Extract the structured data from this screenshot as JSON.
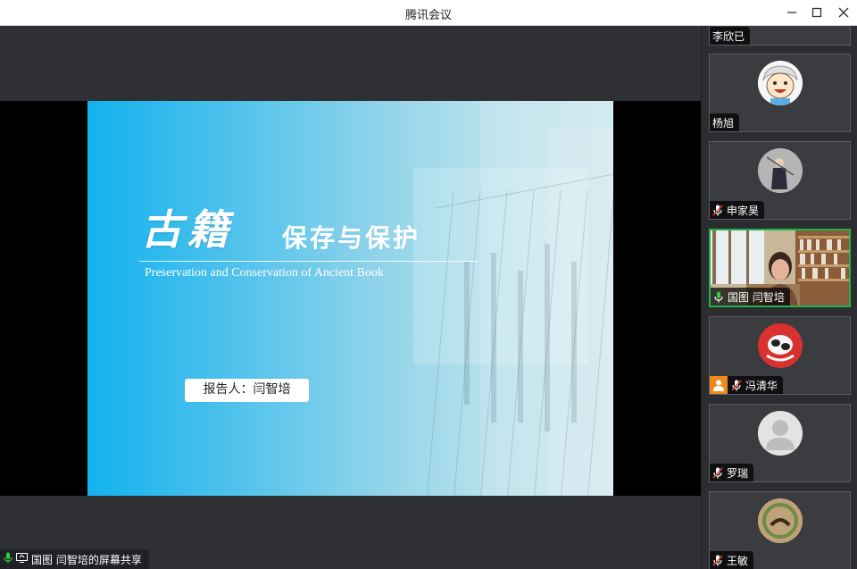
{
  "window": {
    "title": "腾讯会议",
    "minimize_icon": "minimize-icon",
    "maximize_icon": "maximize-icon",
    "close_icon": "close-icon"
  },
  "slide": {
    "title_cn": "古籍",
    "subtitle_cn": "保存与保护",
    "subtitle_en": "Preservation and Conservation of Ancient Book",
    "reporter": "报告人：闫智培"
  },
  "share": {
    "label": "国图 闫智培的屏幕共享",
    "mic_icon": "mic-icon",
    "screen_icon": "screen-share-icon"
  },
  "participants": [
    {
      "name": "李欣已",
      "muted": false
    },
    {
      "name": "杨旭",
      "muted": false,
      "mic": false
    },
    {
      "name": "申家昊",
      "muted": true
    },
    {
      "name": "国图 闫智培",
      "muted": false,
      "speaking": true
    },
    {
      "name": "冯清华",
      "muted": true,
      "host": true
    },
    {
      "name": "罗瑞",
      "muted": true
    },
    {
      "name": "王敏",
      "muted": true
    }
  ],
  "colors": {
    "active_border": "#1fb34a",
    "host_badge": "#f08a1c",
    "slide_gradient_start": "#12b2ee"
  }
}
